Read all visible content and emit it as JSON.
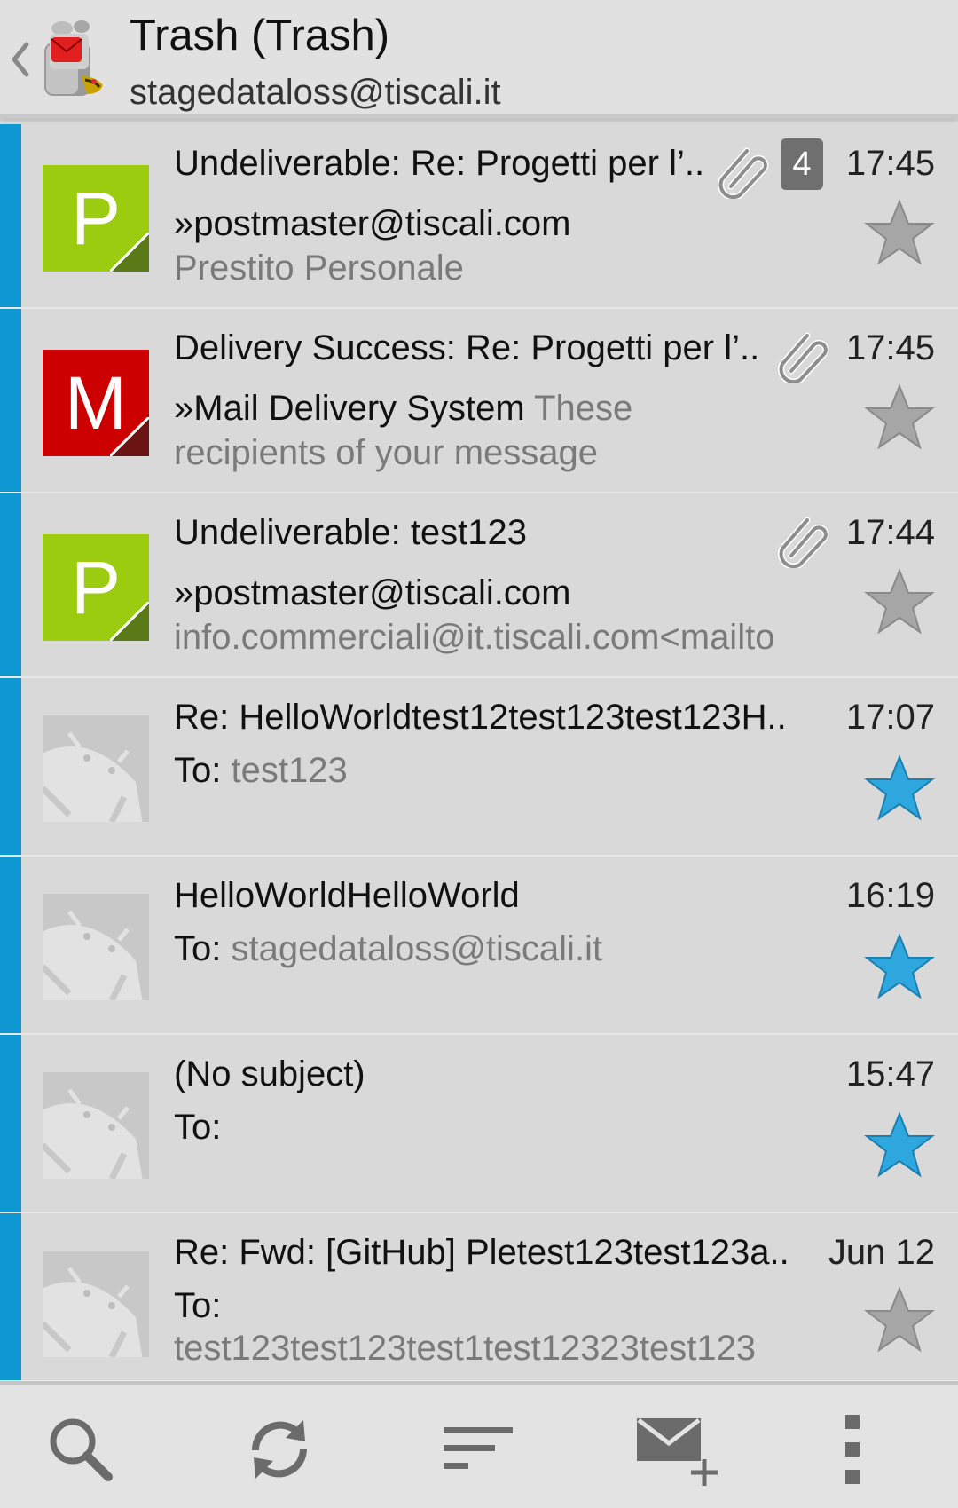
{
  "header": {
    "title": "Trash (Trash)",
    "subtitle": "stagedataloss@tiscali.it",
    "up_icon": "chevron-left-icon",
    "logo_icon": "mail-robot-logo"
  },
  "colors": {
    "accent": "#0e97d0",
    "star_active": "#2ea7de",
    "star_inactive": "#a6a6a6",
    "avatar_green": "#9ccc0f",
    "avatar_red": "#cc0000"
  },
  "messages": [
    {
      "subject": "Undeliverable: Re: Progetti per l’..",
      "time": "17:45",
      "sender": "»postmaster@tiscali.com",
      "preview_inline": "",
      "preview": "Prestito Personale",
      "avatar_letter": "P",
      "avatar_type": "letter-green",
      "attachment": true,
      "thread_count": "4",
      "starred": false
    },
    {
      "subject": "Delivery Success: Re: Progetti per l’..",
      "time": "17:45",
      "sender": "»Mail Delivery System",
      "preview_inline": "These",
      "preview": "recipients of your message",
      "avatar_letter": "M",
      "avatar_type": "letter-red",
      "attachment": true,
      "thread_count": "",
      "starred": false
    },
    {
      "subject": "Undeliverable: test123",
      "time": "17:44",
      "sender": "»postmaster@tiscali.com",
      "preview_inline": "",
      "preview": "info.commerciali@it.tiscali.com<mailto",
      "avatar_letter": "P",
      "avatar_type": "letter-green",
      "attachment": true,
      "thread_count": "",
      "starred": false
    },
    {
      "subject": "Re: HelloWorldtest12test123test123H..",
      "time": "17:07",
      "sender": "To:",
      "preview_inline": "test123",
      "preview": "",
      "avatar_letter": "",
      "avatar_type": "android",
      "attachment": false,
      "thread_count": "",
      "starred": true
    },
    {
      "subject": "HelloWorldHelloWorld",
      "time": "16:19",
      "sender": "To:",
      "preview_inline": "stagedataloss@tiscali.it",
      "preview": "",
      "avatar_letter": "",
      "avatar_type": "android",
      "attachment": false,
      "thread_count": "",
      "starred": true
    },
    {
      "subject": "(No subject)",
      "time": "15:47",
      "sender": "To:",
      "preview_inline": "",
      "preview": "",
      "avatar_letter": "",
      "avatar_type": "android",
      "attachment": false,
      "thread_count": "",
      "starred": true
    },
    {
      "subject": "Re: Fwd: [GitHub] Pletest123test123a..",
      "time": "Jun 12",
      "sender": "To:",
      "preview_inline": "",
      "preview": "test123test123test1test12323test123",
      "avatar_letter": "",
      "avatar_type": "android",
      "attachment": false,
      "thread_count": "",
      "starred": false
    }
  ],
  "bottom_bar": [
    {
      "icon": "search-icon"
    },
    {
      "icon": "refresh-icon"
    },
    {
      "icon": "sort-icon"
    },
    {
      "icon": "compose-icon"
    },
    {
      "icon": "overflow-menu-icon"
    }
  ]
}
